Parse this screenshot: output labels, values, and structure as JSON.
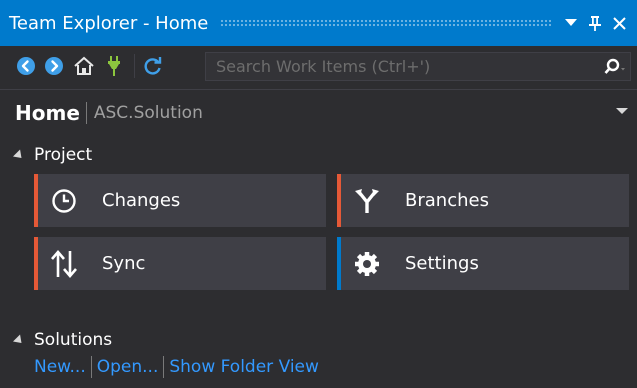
{
  "window": {
    "title": "Team Explorer - Home"
  },
  "toolbar": {
    "search_placeholder": "Search Work Items (Ctrl+')"
  },
  "header": {
    "title": "Home",
    "subtitle": "ASC.Solution"
  },
  "project": {
    "heading": "Project",
    "tiles": [
      {
        "label": "Changes",
        "icon": "clock-icon",
        "accent": "#e55937"
      },
      {
        "label": "Branches",
        "icon": "branch-icon",
        "accent": "#e55937"
      },
      {
        "label": "Sync",
        "icon": "sync-arrows-icon",
        "accent": "#e55937"
      },
      {
        "label": "Settings",
        "icon": "gear-icon",
        "accent": "#007acc"
      }
    ]
  },
  "solutions": {
    "heading": "Solutions",
    "links": [
      "New...",
      "Open...",
      "Show Folder View"
    ]
  },
  "colors": {
    "titlebar": "#007acc",
    "background": "#2d2d30",
    "tile": "#3f3f46",
    "link": "#3399ff",
    "accent_orange": "#e55937",
    "accent_blue": "#007acc",
    "toolbar_blue_icon": "#3f9fe8",
    "toolbar_green_icon": "#8cc63e"
  }
}
